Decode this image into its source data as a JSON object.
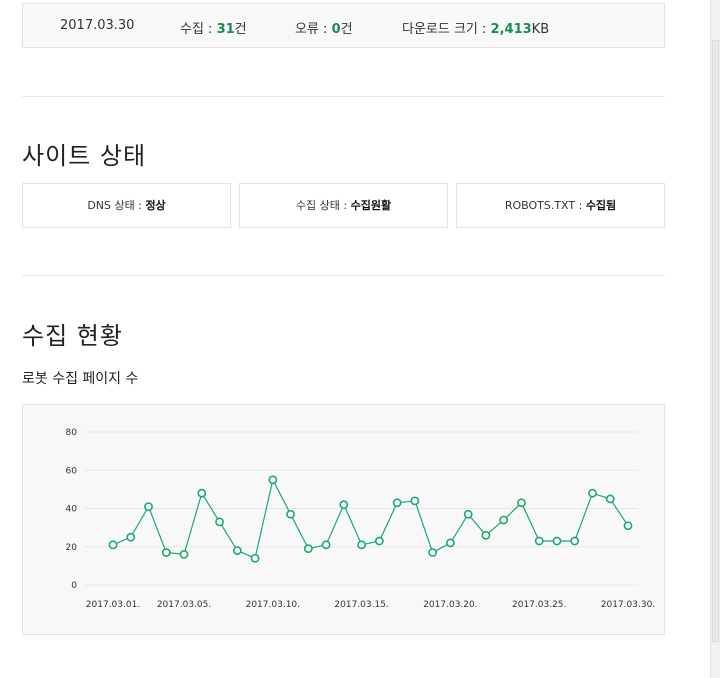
{
  "summary": {
    "date": "2017.03.30",
    "collect_label": "수집 : ",
    "collect_value": "31",
    "collect_unit": "건",
    "error_label": "오류 : ",
    "error_value": "0",
    "error_unit": "건",
    "download_label": "다운로드 크기 : ",
    "download_value": "2,413",
    "download_unit": "KB"
  },
  "site_status": {
    "title": "사이트 상태",
    "dns_label": "DNS 상태 : ",
    "dns_value": "정상",
    "collect_label": "수집 상태 : ",
    "collect_value": "수집원활",
    "robots_label": "ROBOTS.TXT : ",
    "robots_value": "수집됨"
  },
  "collection": {
    "title": "수집 현황",
    "subtitle": "로봇 수집 페이지 수"
  },
  "colors": {
    "accent": "#1a8c52",
    "line": "#1aa96b"
  },
  "chart_data": {
    "type": "line",
    "title": "",
    "xlabel": "",
    "ylabel": "",
    "ylim": [
      0,
      80
    ],
    "yticks": [
      "0",
      "20",
      "40",
      "60",
      "80"
    ],
    "grid": true,
    "x": [
      "2017.03.01.",
      "2017.03.02.",
      "2017.03.03.",
      "2017.03.04.",
      "2017.03.05.",
      "2017.03.06.",
      "2017.03.07.",
      "2017.03.08.",
      "2017.03.09.",
      "2017.03.10.",
      "2017.03.11.",
      "2017.03.12.",
      "2017.03.13.",
      "2017.03.14.",
      "2017.03.15.",
      "2017.03.16.",
      "2017.03.17.",
      "2017.03.18.",
      "2017.03.19.",
      "2017.03.20.",
      "2017.03.21.",
      "2017.03.22.",
      "2017.03.23.",
      "2017.03.24.",
      "2017.03.25.",
      "2017.03.26.",
      "2017.03.27.",
      "2017.03.28.",
      "2017.03.29.",
      "2017.03.30."
    ],
    "xticks": [
      "2017.03.01.",
      "2017.03.05.",
      "2017.03.10.",
      "2017.03.15.",
      "2017.03.20.",
      "2017.03.25.",
      "2017.03.30."
    ],
    "xtick_index": [
      0,
      4,
      9,
      14,
      19,
      24,
      29
    ],
    "series": [
      {
        "values": [
          21,
          25,
          41,
          17,
          16,
          48,
          33,
          18,
          14,
          55,
          37,
          19,
          21,
          42,
          21,
          23,
          43,
          44,
          17,
          22,
          37,
          26,
          34,
          43,
          23,
          23,
          23,
          48,
          45,
          31
        ]
      }
    ]
  }
}
